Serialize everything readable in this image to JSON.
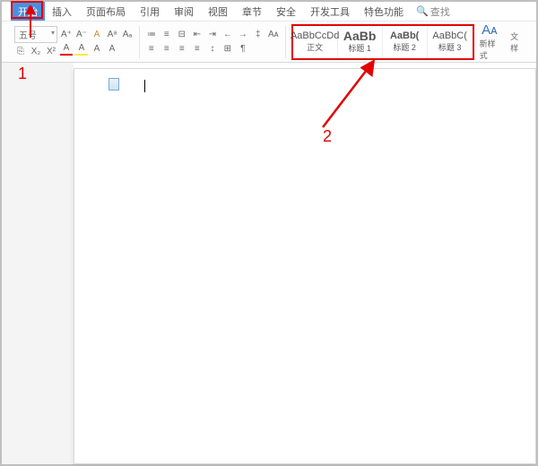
{
  "tabs": {
    "start": "开始",
    "insert": "插入",
    "layout": "页面布局",
    "ref": "引用",
    "review": "审阅",
    "view": "视图",
    "chapter": "章节",
    "security": "安全",
    "dev": "开发工具",
    "special": "特色功能",
    "find": "查找"
  },
  "font": {
    "size": "五号"
  },
  "btn": {
    "formatPainter": "⎘",
    "aPlus": "A⁺",
    "aMinus": "A⁻",
    "clear": "A",
    "super": "Aᵃ",
    "sub": "Aₐ",
    "strike": "X₂",
    "strike2": "X²",
    "fontA": "A",
    "highlight": "A",
    "color": "A",
    "shade": "A",
    "bullets": "≔",
    "numbers": "≡",
    "multilevel": "⊟",
    "indentDec": "⇤",
    "indentInc": "⇥",
    "indentDec2": "←",
    "indentInc2": "→",
    "lineH": "‡",
    "alignL": "≡",
    "alignC": "≡",
    "alignR": "≡",
    "alignJ": "≡",
    "spacing": "↕",
    "border": "⊞",
    "para": "¶",
    "font2": "Aᴀ"
  },
  "styles": {
    "s0": {
      "preview": "AaBbCcDd",
      "name": "正文"
    },
    "s1": {
      "preview": "AaBb",
      "name": "标题 1"
    },
    "s2": {
      "preview": "AaBb(",
      "name": "标题 2"
    },
    "s3": {
      "preview": "AaBbC(",
      "name": "标题 3"
    }
  },
  "newStyle": {
    "icon": "Aᴀ",
    "label": "新样式"
  },
  "moreStyle": "文样",
  "annot": {
    "one": "1",
    "two": "2"
  }
}
